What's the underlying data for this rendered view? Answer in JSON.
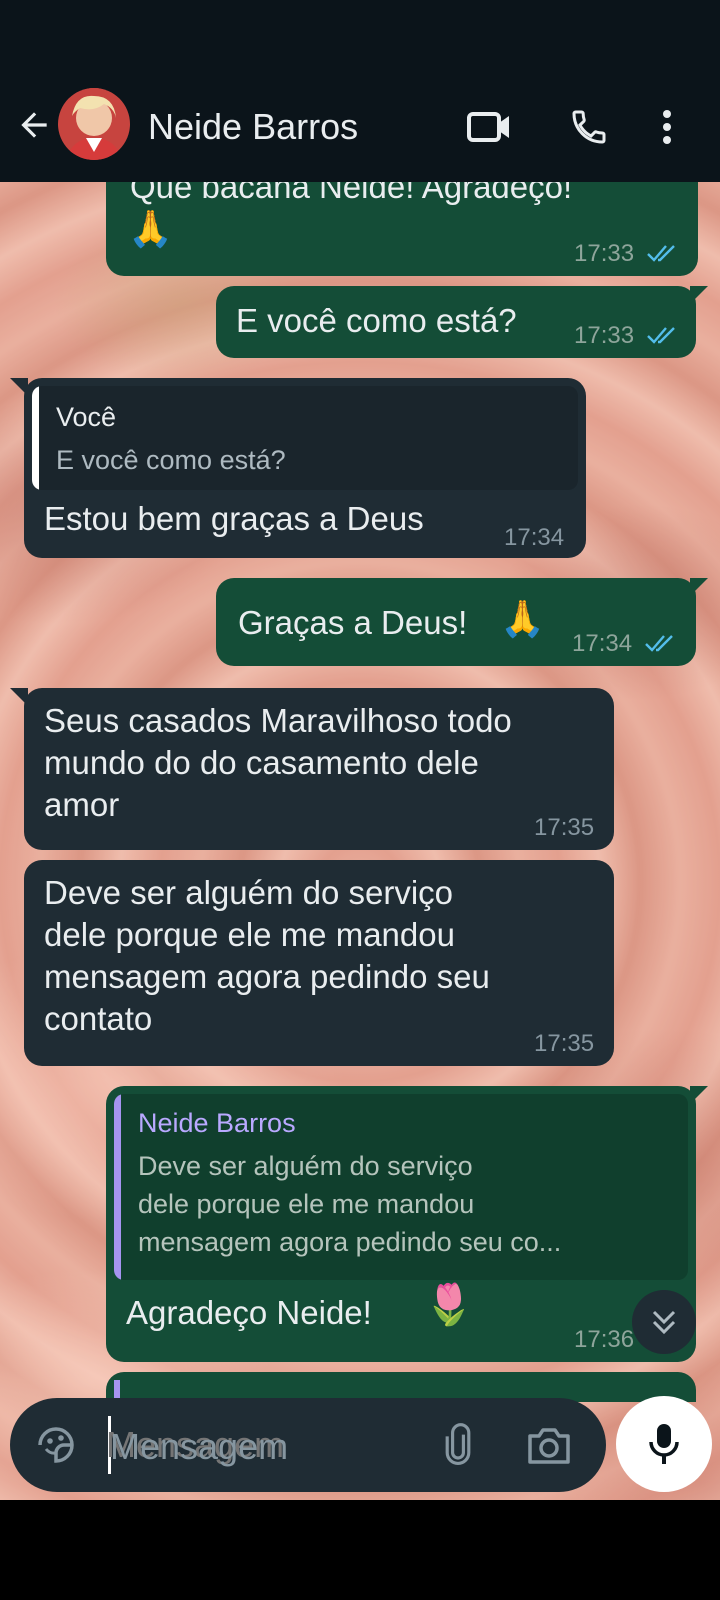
{
  "header": {
    "contact_name": "Neide Barros"
  },
  "messages": [
    {
      "id": "m1",
      "direction": "outgoing",
      "text": "Que bacana Neide! Agradeço!",
      "emoji": "🙏",
      "time": "17:33",
      "read": true
    },
    {
      "id": "m2",
      "direction": "outgoing",
      "text": "E você como está?",
      "time": "17:33",
      "read": true
    },
    {
      "id": "m3",
      "direction": "incoming",
      "quote_author": "Você",
      "quote_text": "E você como está?",
      "text": "Estou bem graças a Deus",
      "time": "17:34"
    },
    {
      "id": "m4",
      "direction": "outgoing",
      "text": "Graças a Deus!",
      "emoji": "🙏",
      "time": "17:34",
      "read": true
    },
    {
      "id": "m5",
      "direction": "incoming",
      "lines": [
        "Seus casados Maravilhoso todo",
        "mundo do do casamento dele",
        "amor"
      ],
      "time": "17:35"
    },
    {
      "id": "m6",
      "direction": "incoming",
      "lines": [
        "Deve ser alguém do serviço",
        "dele porque ele me mandou",
        "mensagem agora pedindo seu",
        "contato"
      ],
      "time": "17:35"
    },
    {
      "id": "m7",
      "direction": "outgoing",
      "quote_author": "Neide Barros",
      "quote_lines": [
        "Deve ser alguém do serviço",
        "dele porque ele me mandou",
        "mensagem agora pedindo seu co..."
      ],
      "text": "Agradeço Neide!",
      "emoji": "🌷",
      "time": "17:36"
    }
  ],
  "composer": {
    "placeholder": "Mensagem"
  },
  "icons": {
    "back": "arrow-left-icon",
    "video": "video-call-icon",
    "call": "phone-icon",
    "menu": "more-vert-icon",
    "sticker": "sticker-icon",
    "attach": "paperclip-icon",
    "camera": "camera-icon",
    "mic": "microphone-icon",
    "scroll": "double-chevron-down-icon"
  },
  "colors": {
    "header_bg": "#0b141a",
    "outgoing_bubble": "#144d37",
    "incoming_bubble": "#1f2c34",
    "read_ticks": "#53bdeb",
    "quote_bar_you": "#ffffff",
    "quote_bar_contact": "#a694f0"
  }
}
